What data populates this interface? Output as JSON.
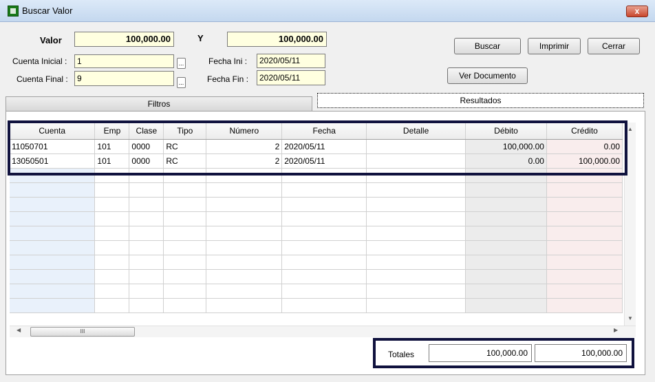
{
  "window": {
    "title": "Buscar Valor",
    "close_label": "x"
  },
  "form": {
    "valor_label": "Valor",
    "valor_value": "100,000.00",
    "y_label": "Y",
    "y_value": "100,000.00",
    "cuenta_inicial_label": "Cuenta Inicial :",
    "cuenta_inicial_value": "1",
    "cuenta_final_label": "Cuenta Final :",
    "cuenta_final_value": "9",
    "fecha_ini_label": "Fecha Ini :",
    "fecha_ini_value": "2020/05/11",
    "fecha_fin_label": "Fecha Fin :",
    "fecha_fin_value": "2020/05/11",
    "ellipsis": "..."
  },
  "buttons": {
    "buscar": "Buscar",
    "imprimir": "Imprimir",
    "cerrar": "Cerrar",
    "ver_documento": "Ver Documento"
  },
  "tabs": {
    "filtros": "Filtros",
    "resultados": "Resultados"
  },
  "grid": {
    "columns": [
      "Cuenta",
      "Emp",
      "Clase",
      "Tipo",
      "Número",
      "Fecha",
      "Detalle",
      "Débito",
      "Crédito"
    ],
    "rows": [
      [
        "11050701",
        "101",
        "0000",
        "RC",
        "2",
        "2020/05/11",
        "",
        "100,000.00",
        "0.00"
      ],
      [
        "13050501",
        "101",
        "0000",
        "RC",
        "2",
        "2020/05/11",
        "",
        "0.00",
        "100,000.00"
      ]
    ],
    "empty_rows": 10,
    "scroll_thumb": "III"
  },
  "totals": {
    "label": "Totales",
    "debito": "100,000.00",
    "credito": "100,000.00"
  },
  "colors": {
    "highlight_border": "#10123e",
    "field_bg": "#ffffe0"
  }
}
